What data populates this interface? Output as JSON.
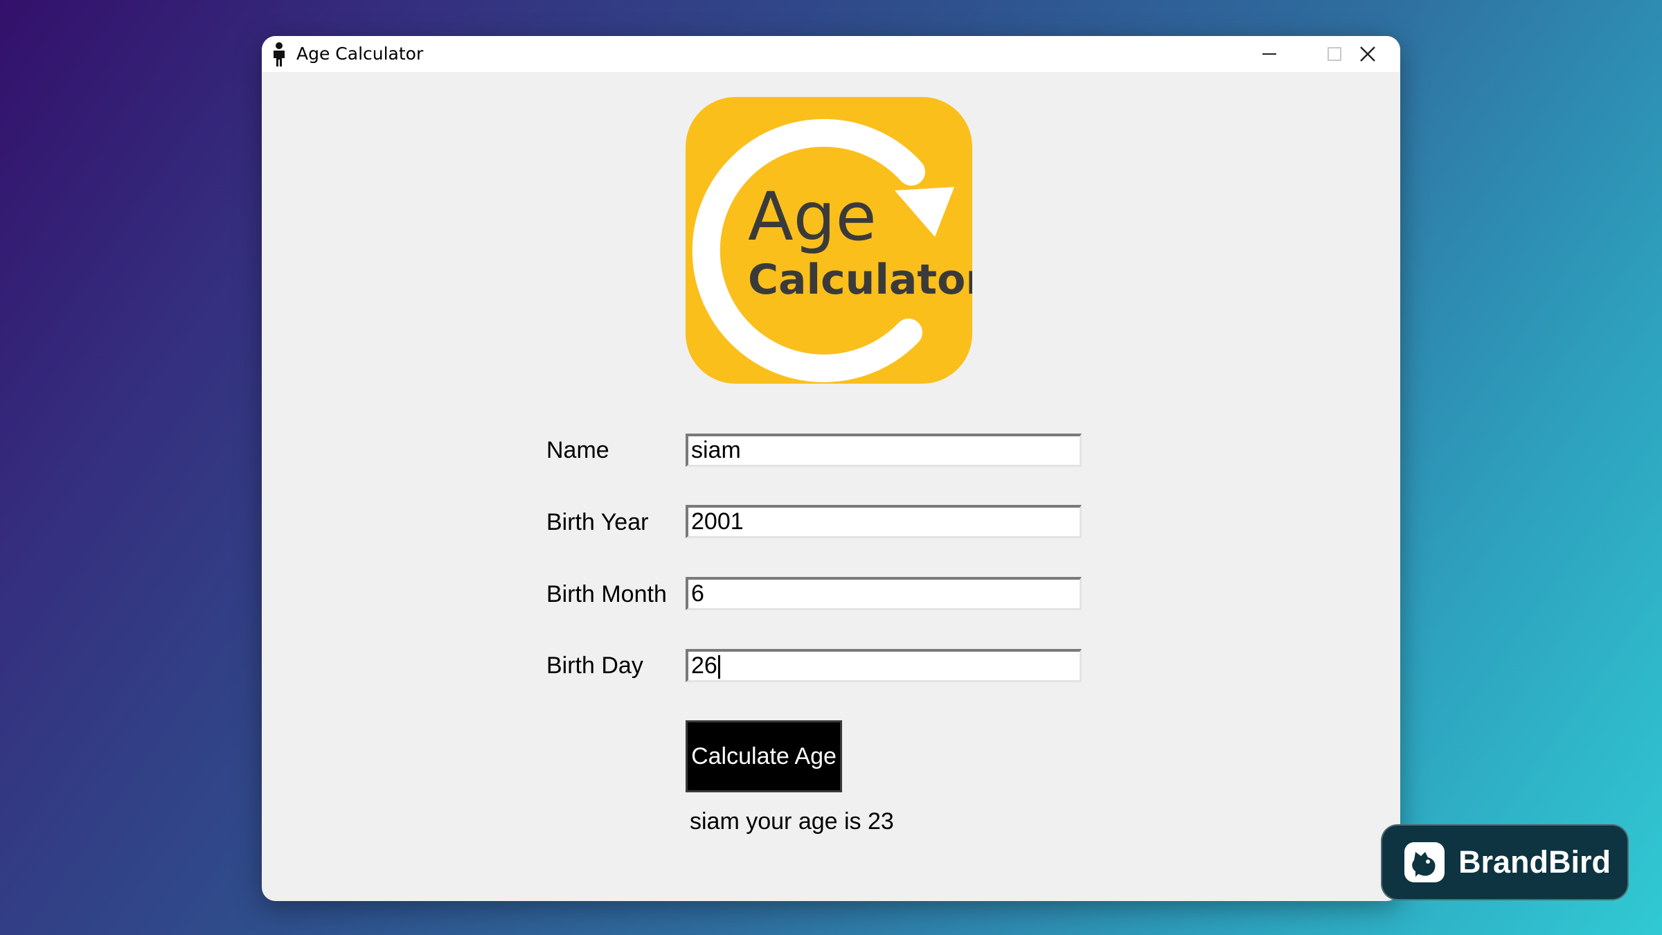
{
  "window": {
    "title": "Age Calculator",
    "controls": {
      "minimize": "minimize",
      "maximize": "maximize",
      "close": "close"
    }
  },
  "logo": {
    "line1": "Age",
    "line2": "Calculator",
    "color": "#fbbf1c"
  },
  "form": {
    "fields": [
      {
        "label": "Name",
        "value": "siam"
      },
      {
        "label": "Birth Year",
        "value": "2001"
      },
      {
        "label": "Birth Month",
        "value": "6"
      },
      {
        "label": "Birth Day",
        "value": "26"
      }
    ],
    "submit_label": "Calculate Age",
    "result": "siam your age is 23"
  },
  "watermark": {
    "brand": "BrandBird"
  },
  "icons": [
    "person-icon",
    "minimize-icon",
    "maximize-icon",
    "close-icon",
    "refresh-arrow-icon",
    "brandbird-icon"
  ]
}
